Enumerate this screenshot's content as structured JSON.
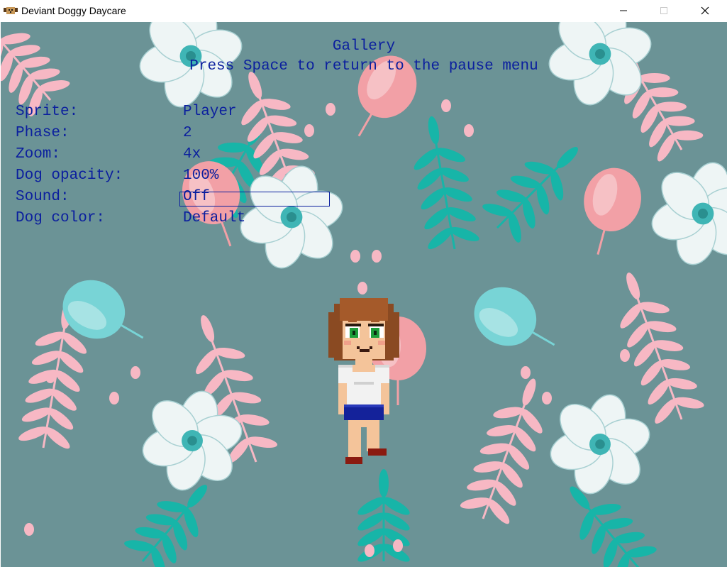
{
  "window": {
    "title": "Deviant Doggy Daycare",
    "icon": "dog-icon",
    "controls": [
      "minimize-icon",
      "maximize-icon",
      "close-icon"
    ]
  },
  "gallery": {
    "title": "Gallery",
    "instruction": "Press Space to return to the pause menu",
    "focused_setting": "Sound",
    "settings": [
      {
        "label": "Sprite:",
        "value": "Player"
      },
      {
        "label": "Phase:",
        "value": "2"
      },
      {
        "label": "Zoom:",
        "value": "4x"
      },
      {
        "label": "Dog opacity:",
        "value": "100%"
      },
      {
        "label": "Sound:",
        "value": "Off"
      },
      {
        "label": "Dog color:",
        "value": "Default"
      }
    ]
  },
  "colors": {
    "background": "#6b9396",
    "text": "#0b1f9e",
    "flower_white": "#eef5f5",
    "flower_center": "#3fb5b5",
    "leaf_pink": "#f7b8c4",
    "leaf_teal": "#17b5a8",
    "tulip_pink": "#f2a0a6",
    "tulip_teal": "#78d4d6"
  }
}
